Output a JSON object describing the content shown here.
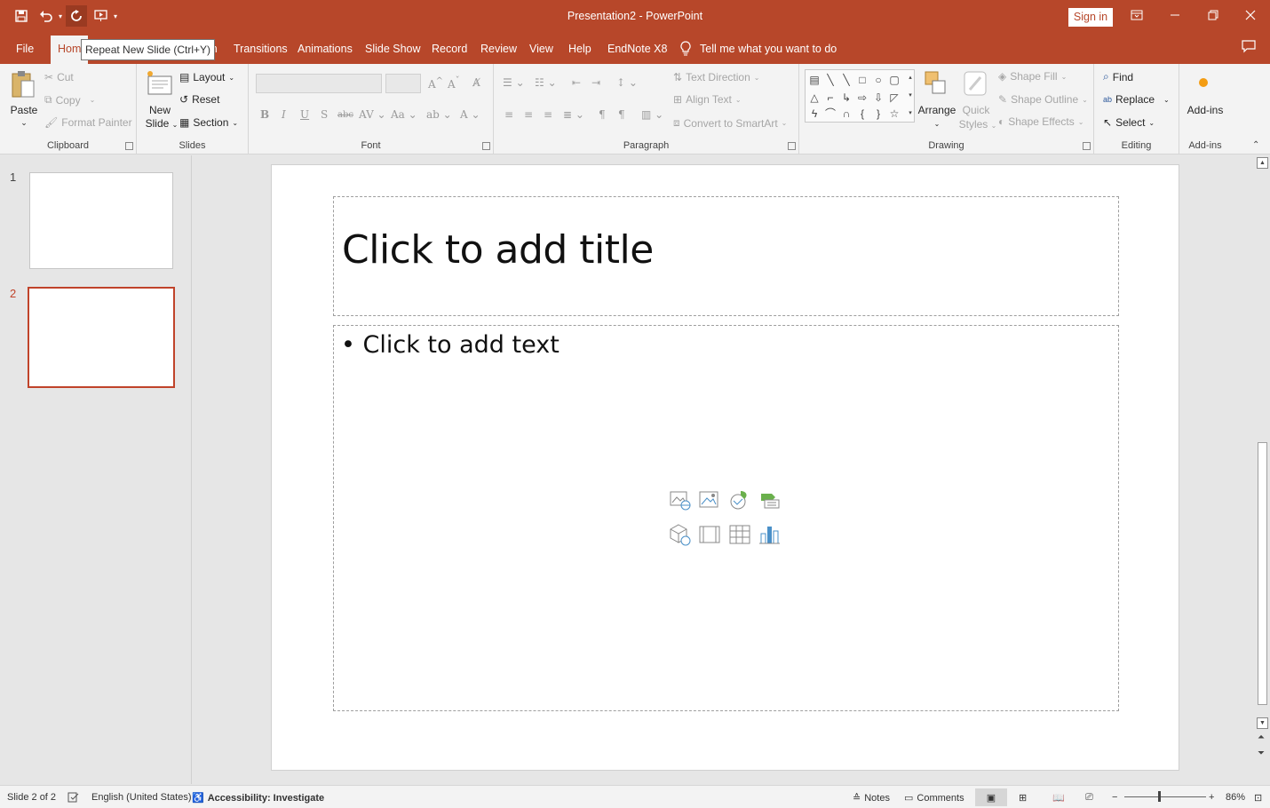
{
  "window": {
    "title": "Presentation2  -  PowerPoint",
    "sign_in": "Sign in",
    "tooltip": "Repeat New Slide (Ctrl+Y)"
  },
  "tabs": [
    {
      "label": "File"
    },
    {
      "label": "Hom"
    },
    {
      "label": "ign"
    },
    {
      "label": "Transitions"
    },
    {
      "label": "Animations"
    },
    {
      "label": "Slide Show"
    },
    {
      "label": "Record"
    },
    {
      "label": "Review"
    },
    {
      "label": "View"
    },
    {
      "label": "Help"
    },
    {
      "label": "EndNote X8"
    }
  ],
  "tell_me": "Tell me what you want to do",
  "ribbon": {
    "clipboard": {
      "label": "Clipboard",
      "paste": "Paste",
      "cut": "Cut",
      "copy": "Copy",
      "format_painter": "Format Painter"
    },
    "slides": {
      "label": "Slides",
      "new_slide_1": "New",
      "new_slide_2": "Slide",
      "layout": "Layout",
      "reset": "Reset",
      "section": "Section"
    },
    "font": {
      "label": "Font"
    },
    "paragraph": {
      "label": "Paragraph",
      "text_direction": "Text Direction",
      "align_text": "Align Text",
      "convert_smartart": "Convert to SmartArt"
    },
    "drawing": {
      "label": "Drawing",
      "arrange": "Arrange",
      "quick_styles_1": "Quick",
      "quick_styles_2": "Styles",
      "shape_fill": "Shape Fill",
      "shape_outline": "Shape Outline",
      "shape_effects": "Shape Effects"
    },
    "editing": {
      "label": "Editing",
      "find": "Find",
      "replace": "Replace",
      "select": "Select"
    },
    "addins": {
      "label": "Add-ins",
      "button": "Add-ins"
    }
  },
  "thumbnails": [
    {
      "number": "1"
    },
    {
      "number": "2"
    }
  ],
  "slide": {
    "title_placeholder": "Click to add title",
    "body_placeholder": "Click to add text"
  },
  "status": {
    "slide_counter": "Slide 2 of 2",
    "language": "English (United States)",
    "accessibility": "Accessibility: Investigate",
    "notes": "Notes",
    "comments": "Comments",
    "zoom": "86%"
  },
  "colors": {
    "accent": "#b7472a",
    "selected_thumb": "#c0432a"
  }
}
